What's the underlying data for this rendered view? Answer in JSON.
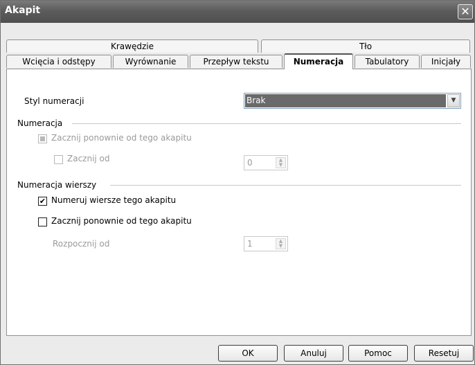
{
  "window": {
    "title": "Akapit",
    "close_glyph": "✕"
  },
  "tabs_back": [
    "Krawędzie",
    "Tło"
  ],
  "tabs_front": [
    "Wcięcia i odstępy",
    "Wyrównanie",
    "Przepływ tekstu",
    "Numeracja",
    "Tabulatory",
    "Inicjały"
  ],
  "active_tab": "Numeracja",
  "numbering_style": {
    "label": "Styl numeracji",
    "value": "Brak"
  },
  "numbering": {
    "heading": "Numeracja",
    "restart_label": "Zacznij ponownie od tego akapitu",
    "start_at_label": "Zacznij od",
    "start_at_value": "0"
  },
  "line_numbering": {
    "heading": "Numeracja wierszy",
    "number_lines_label": "Numeruj wiersze tego akapitu",
    "number_lines_checked": true,
    "restart_label": "Zacznij ponownie od tego akapitu",
    "restart_checked": false,
    "start_with_label": "Rozpocznij od",
    "start_with_value": "1"
  },
  "buttons": {
    "ok": "OK",
    "cancel": "Anuluj",
    "help": "Pomoc",
    "reset": "Resetuj"
  },
  "colors": {
    "titlebar": "#5c5c5c",
    "selection": "#6a6a6a"
  }
}
